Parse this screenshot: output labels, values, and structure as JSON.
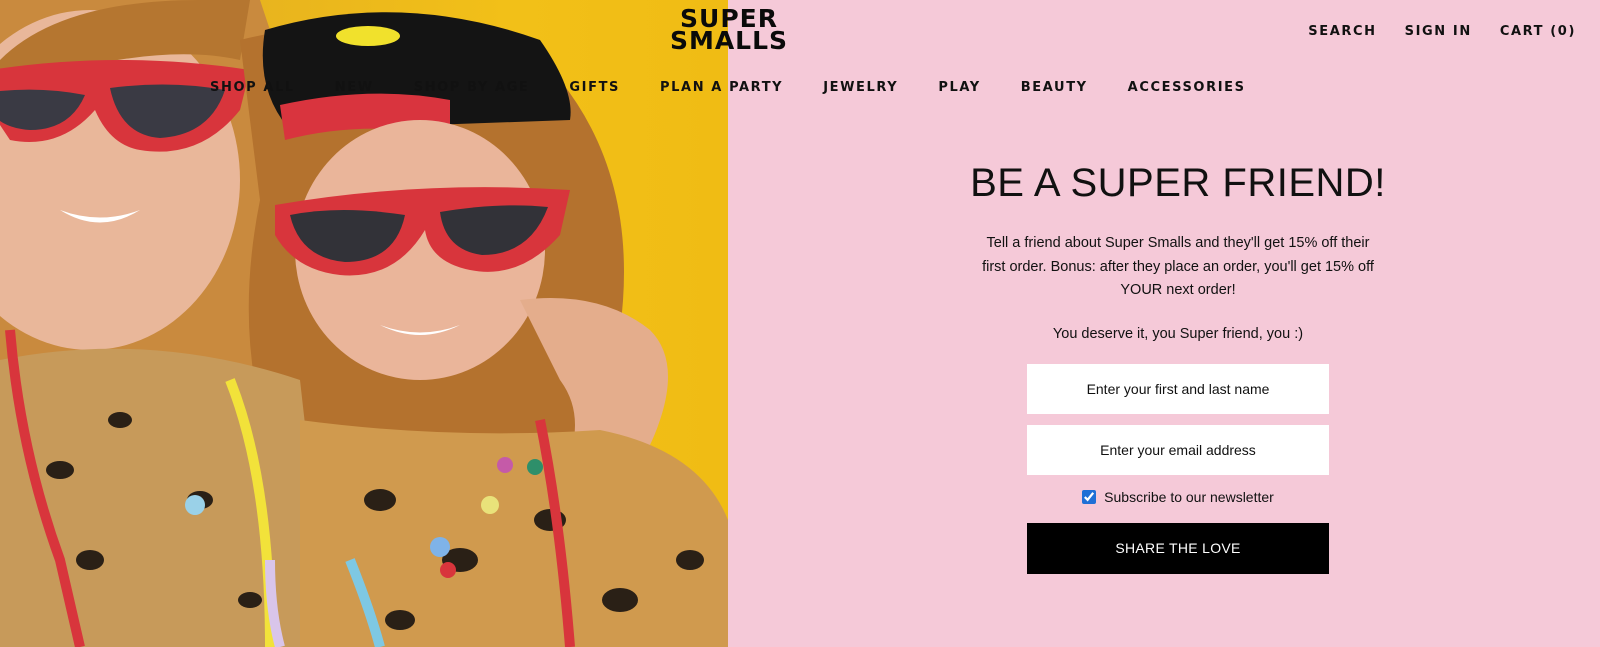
{
  "brand": {
    "logo_line1": "SUPER",
    "logo_line2": "SMALLS"
  },
  "utility_nav": {
    "search": "SEARCH",
    "sign_in": "SIGN IN",
    "cart": "CART (0)"
  },
  "main_nav": [
    "SHOP ALL",
    "NEW",
    "SHOP BY AGE",
    "GIFTS",
    "PLAN A PARTY",
    "JEWELRY",
    "PLAY",
    "BEAUTY",
    "ACCESSORIES"
  ],
  "referral": {
    "title": "BE A SUPER FRIEND!",
    "description": "Tell a friend about Super Smalls and they'll get 15% off their first order. Bonus: after they place an order, you'll get 15% off YOUR next order!",
    "tagline": "You deserve it, you Super friend, you :)",
    "name_placeholder": "Enter your first and last name",
    "email_placeholder": "Enter your email address",
    "newsletter_label": "Subscribe to our newsletter",
    "newsletter_checked": true,
    "submit_label": "SHARE THE LOVE"
  },
  "colors": {
    "background": "#f5c9d8",
    "photo_backdrop": "#f0bc14",
    "button": "#000000",
    "text": "#111111"
  }
}
